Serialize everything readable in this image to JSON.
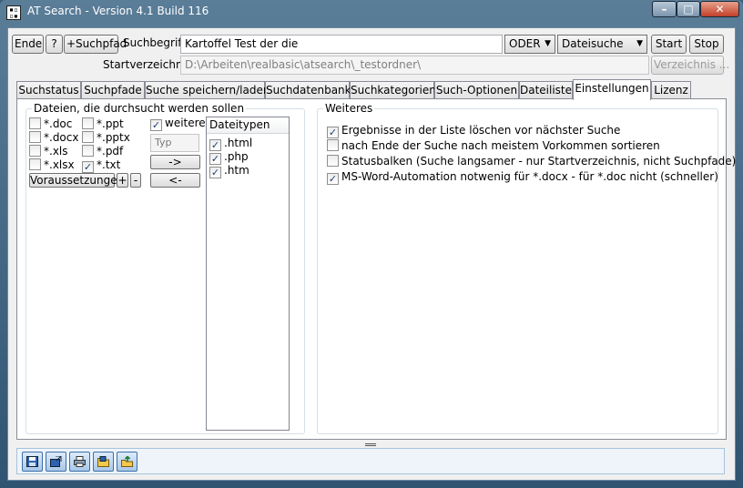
{
  "window": {
    "title": "AT Search - Version 4.1 Build 116",
    "icon": "app-icon"
  },
  "toolbar": {
    "ende": "Ende",
    "help": "?",
    "suchpfad": "+Suchpfad",
    "suchbegriff_label": "Suchbegriff",
    "suchbegriff_value": "Kartoffel Test der die",
    "mode": "ODER",
    "scope": "Dateisuche",
    "start": "Start",
    "stop": "Stop",
    "startverzeichnis_label": "Startverzeichnis",
    "startverzeichnis_value": "D:\\Arbeiten\\realbasic\\atsearch\\_testordner\\",
    "verzeichnis_button": "Verzeichnis ..."
  },
  "tabs": [
    {
      "label": "Suchstatus"
    },
    {
      "label": "Suchpfade"
    },
    {
      "label": "Suche speichern/laden"
    },
    {
      "label": "Suchdatenbank"
    },
    {
      "label": "Suchkategorien"
    },
    {
      "label": "Such-Optionen"
    },
    {
      "label": "Dateiliste"
    },
    {
      "label": "Einstellungen",
      "active": true
    },
    {
      "label": "Lizenz"
    }
  ],
  "files_group": {
    "title": "Dateien, die durchsucht werden sollen",
    "types": [
      {
        "label": "*.doc",
        "checked": false
      },
      {
        "label": "*.ppt",
        "checked": false
      },
      {
        "label": "*.docx",
        "checked": false
      },
      {
        "label": "*.pptx",
        "checked": false
      },
      {
        "label": "*.xls",
        "checked": false
      },
      {
        "label": "*.pdf",
        "checked": false
      },
      {
        "label": "*.xlsx",
        "checked": false
      },
      {
        "label": "*.txt",
        "checked": true
      }
    ],
    "voraussetzungen": "Voraussetzungen",
    "plus": "+",
    "minus": "-",
    "weitere": {
      "label": "weitere",
      "checked": true
    },
    "typ_placeholder": "Typ",
    "add_arrow": "->",
    "remove_arrow": "<-",
    "list_header": "Dateitypen",
    "list_items": [
      {
        "label": ".html",
        "checked": true
      },
      {
        "label": ".php",
        "checked": true
      },
      {
        "label": ".htm",
        "checked": true
      }
    ]
  },
  "weiteres_group": {
    "title": "Weiteres",
    "options": [
      {
        "label": "Ergebnisse in der Liste löschen vor nächster Suche",
        "checked": true
      },
      {
        "label": "nach Ende der Suche nach meistem Vorkommen sortieren",
        "checked": false
      },
      {
        "label": "Statusbalken (Suche langsamer - nur Startverzeichnis, nicht Suchpfade)",
        "checked": false
      },
      {
        "label": "MS-Word-Automation notwenig für *.docx - für *.doc nicht (schneller)",
        "checked": true
      }
    ]
  },
  "bottom_toolbar": [
    {
      "icon": "save-icon"
    },
    {
      "icon": "open-icon"
    },
    {
      "icon": "print-icon"
    },
    {
      "icon": "folder-icon"
    },
    {
      "icon": "export-icon"
    }
  ],
  "colors": {
    "accent": "#3c6fa8",
    "check": "#1b3e7a"
  }
}
